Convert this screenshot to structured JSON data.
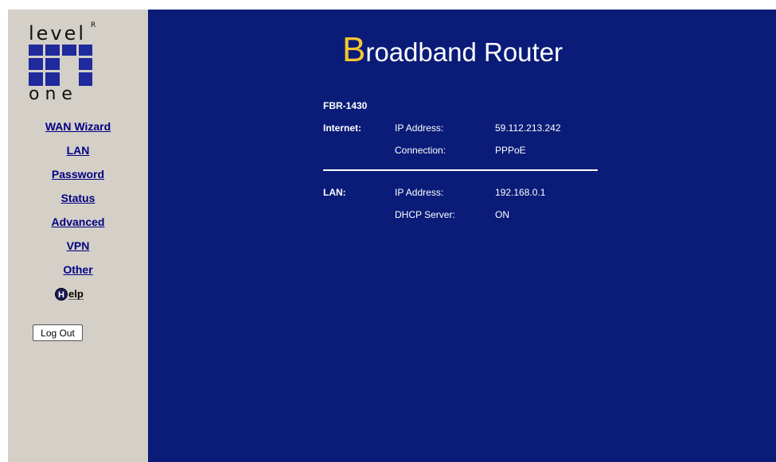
{
  "logo": {
    "top_word": "level",
    "registered_mark": "R",
    "bottom_word": "one"
  },
  "nav": {
    "items": [
      {
        "label": "WAN Wizard"
      },
      {
        "label": "LAN"
      },
      {
        "label": "Password"
      },
      {
        "label": "Status"
      },
      {
        "label": "Advanced"
      },
      {
        "label": "VPN"
      },
      {
        "label": "Other"
      }
    ],
    "help_first": "H",
    "help_rest": "elp",
    "logout_label": "Log Out"
  },
  "header": {
    "title_first": "B",
    "title_rest": "roadband Router"
  },
  "model": "FBR-1430",
  "internet": {
    "label": "Internet:",
    "ip_label": "IP Address:",
    "ip_value": "59.112.213.242",
    "conn_label": "Connection:",
    "conn_value": "PPPoE"
  },
  "lan": {
    "label": "LAN:",
    "ip_label": "IP Address:",
    "ip_value": "192.168.0.1",
    "dhcp_label": "DHCP Server:",
    "dhcp_value": "ON"
  },
  "colors": {
    "main_bg": "#0a1c78",
    "sidebar_bg": "#d4d0c8",
    "accent": "#f5c62f",
    "link": "#000080"
  },
  "icons": [
    "levelone-logo-icon",
    "help-icon"
  ]
}
